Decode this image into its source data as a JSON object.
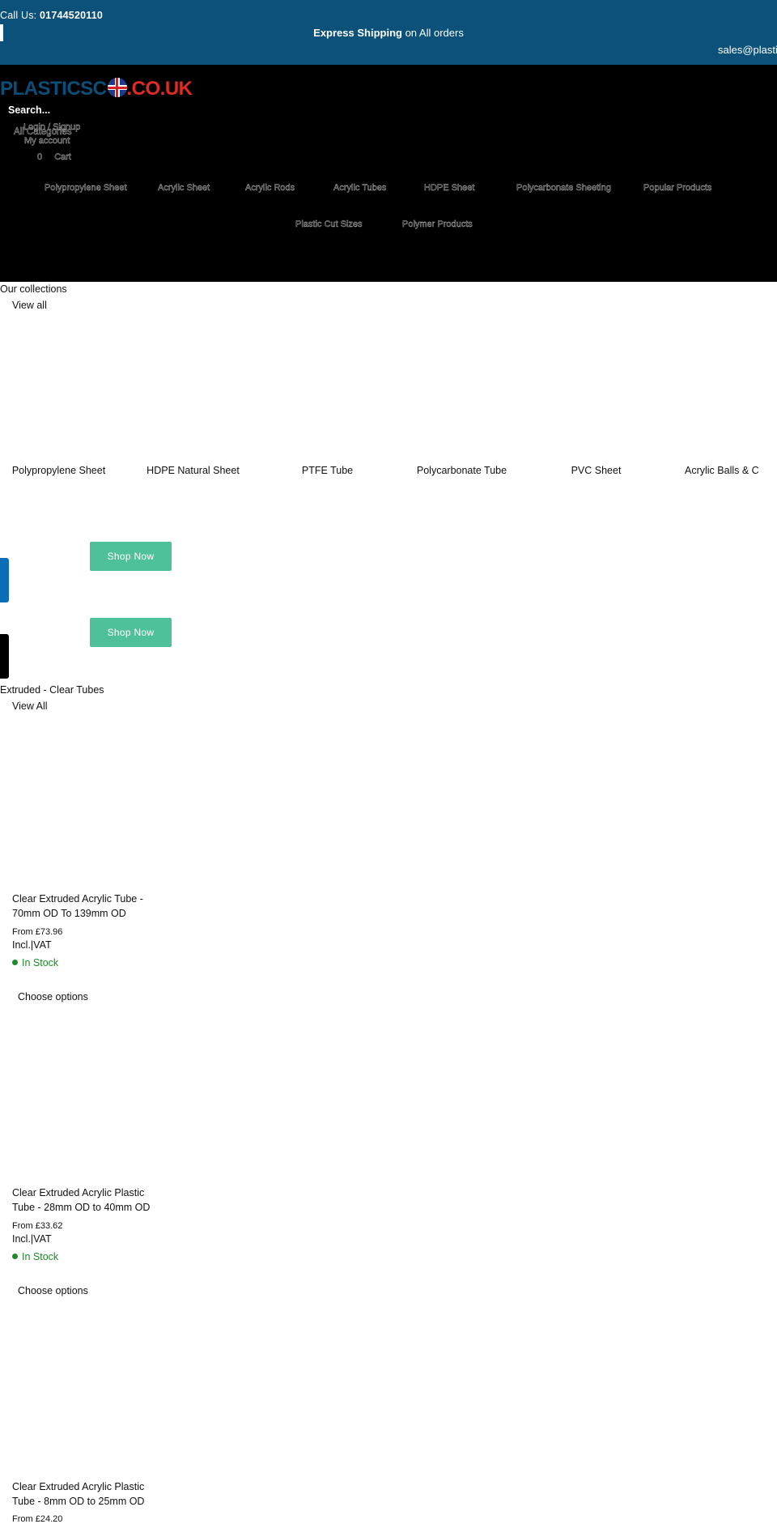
{
  "topbar": {
    "call_label": "Call Us: ",
    "phone": "01744520110",
    "shipping_bold": "Express Shipping",
    "shipping_rest": " on All orders",
    "email": "sales@plastic"
  },
  "header": {
    "logo": {
      "plastic": "PLASTICSC",
      "couk": ".CO.UK"
    },
    "search_placeholder": "Search...",
    "login_label": "Login / Signup",
    "all_categories_label": "All Categories",
    "my_account_label": "My account",
    "cart_count": "0",
    "cart_label": "Cart",
    "nav_row1": [
      "Polypropylene Sheet",
      "Acrylic Sheet",
      "Acrylic Rods",
      "Acrylic Tubes",
      "HDPE Sheet",
      "Polycarbonate Sheeting",
      "Popular Products"
    ],
    "nav_row2": [
      "Plastic Cut Sizes",
      "Polymer Products"
    ]
  },
  "collections": {
    "title": "Our collections",
    "view_all": "View all",
    "items": [
      "Polypropylene Sheet",
      "HDPE Natural Sheet",
      "PTFE Tube",
      "Polycarbonate Tube",
      "PVC Sheet",
      "Acrylic Balls & C"
    ],
    "shop_now_1": "Shop Now",
    "shop_now_2": "Shop Now"
  },
  "products_section": {
    "title": "Extruded - Clear Tubes",
    "view_all": "View All",
    "products": [
      {
        "title": "Clear Extruded Acrylic Tube - 70mm OD To 139mm OD",
        "price": "From £73.96",
        "vat": "Incl.|VAT",
        "stock": "In Stock",
        "button": "Choose options"
      },
      {
        "title": "Clear Extruded Acrylic Plastic Tube - 28mm OD to 40mm OD",
        "price": "From £33.62",
        "vat": "Incl.|VAT",
        "stock": "In Stock",
        "button": "Choose options"
      },
      {
        "title": "Clear Extruded Acrylic Plastic Tube - 8mm OD to 25mm OD",
        "price": "From £24.20",
        "vat": "Incl.|VAT",
        "stock": "In Stock",
        "button": "Choose options"
      }
    ]
  },
  "colors": {
    "topbar_bg": "#0b5179",
    "header_bg": "#000000",
    "logo_blue": "#0b4f79",
    "logo_red": "#e02a23",
    "shop_button": "#4fc19a",
    "in_stock": "#1f8a2a",
    "side_tab_blue": "#0b6db8"
  },
  "icons": {
    "flag": "uk-flag-icon",
    "stock_dot": "in-stock-dot-icon"
  }
}
